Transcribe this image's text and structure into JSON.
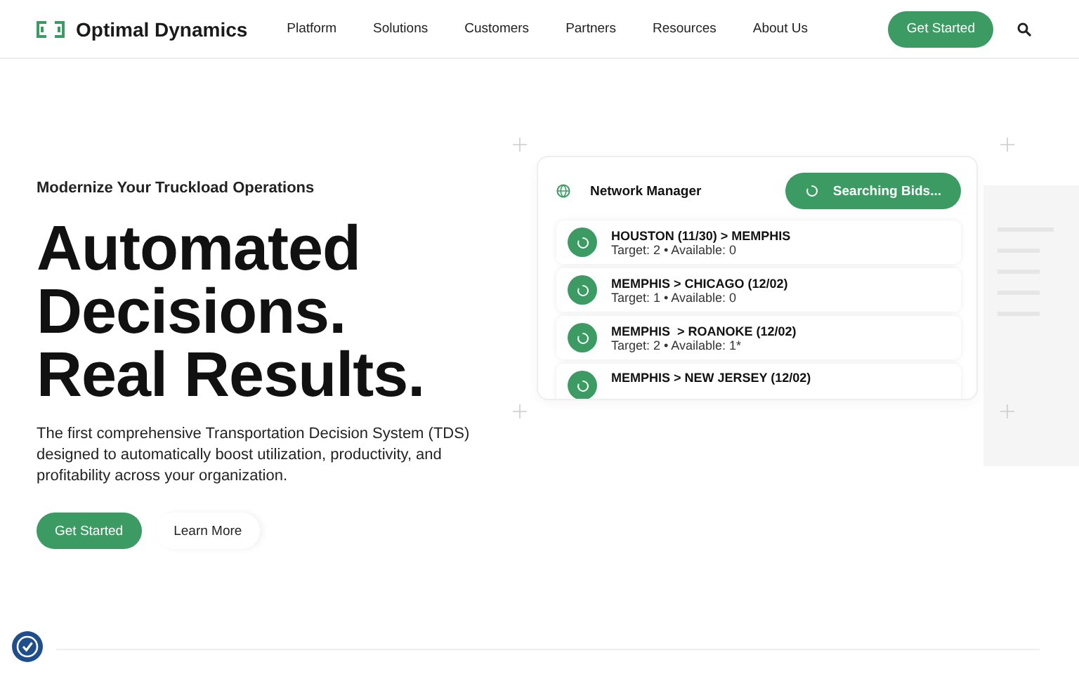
{
  "header": {
    "logo": "Optimal Dynamics",
    "nav": [
      "Platform",
      "Solutions",
      "Customers",
      "Partners",
      "Resources",
      "About Us"
    ],
    "cta": "Get Started"
  },
  "hero": {
    "eyebrow": "Modernize Your Truckload Operations",
    "headline": [
      "Automated",
      "Decisions.",
      "Real Results."
    ],
    "body": "The first comprehensive Transportation Decision System (TDS) designed to automatically boost utilization, productivity, and profitability across your organization.",
    "primary": "Get Started",
    "secondary": "Learn More"
  },
  "card": {
    "title": "Network Manager",
    "status": "Searching Bids...",
    "rows": [
      {
        "route": "HOUSTON (11/30) > MEMPHIS",
        "detail": "Target: 2 • Available: 0"
      },
      {
        "route": "MEMPHIS > CHICAGO (12/02)",
        "detail": "Target: 1 • Available: 0"
      },
      {
        "route": "MEMPHIS  > ROANOKE (12/02)",
        "detail": "Target: 2 • Available: 1*"
      },
      {
        "route": "MEMPHIS > NEW JERSEY (12/02)"
      }
    ]
  }
}
